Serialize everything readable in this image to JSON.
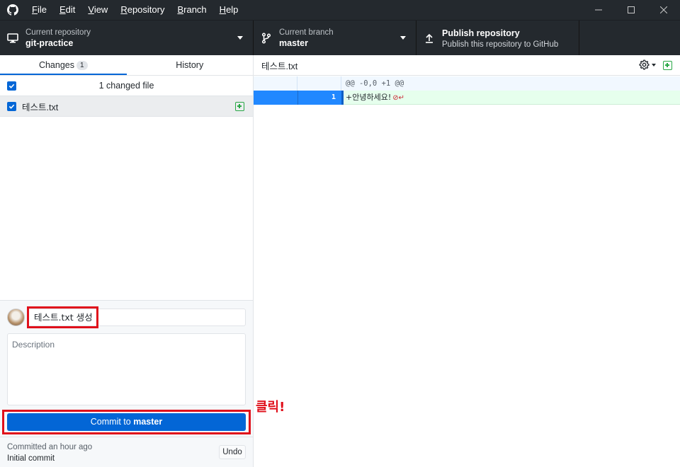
{
  "menu": {
    "file": "File",
    "edit": "Edit",
    "view": "View",
    "repository": "Repository",
    "branch": "Branch",
    "help": "Help"
  },
  "toolbar": {
    "repo_label": "Current repository",
    "repo_value": "git-practice",
    "branch_label": "Current branch",
    "branch_value": "master",
    "publish_title": "Publish repository",
    "publish_subtitle": "Publish this repository to GitHub"
  },
  "tabs": {
    "changes": "Changes",
    "changes_count": "1",
    "history": "History"
  },
  "changes": {
    "summary": "1 changed file",
    "files": [
      {
        "name": "테스트.txt",
        "checked": true,
        "status": "added"
      }
    ]
  },
  "commit": {
    "summary_value": "테스트.txt 생성",
    "description_placeholder": "Description",
    "button_prefix": "Commit to ",
    "button_branch": "master"
  },
  "last_commit": {
    "time": "Committed an hour ago",
    "message": "Initial commit",
    "undo": "Undo"
  },
  "diff": {
    "file_name": "테스트.txt",
    "hunk_header": "@@ -0,0 +1 @@",
    "line_number": "1",
    "added_line": "+안녕하세요!"
  },
  "annotation": "클릭!",
  "colors": {
    "accent": "#0366d6",
    "highlight": "#e0101b",
    "added": "#28a745"
  }
}
